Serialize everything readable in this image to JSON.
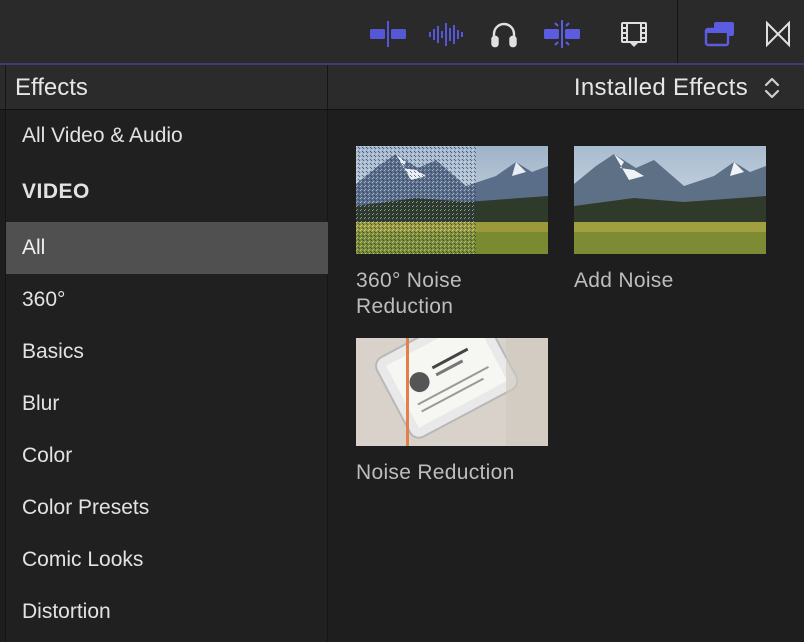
{
  "toolbar": {
    "icons": [
      "clip-appearance-icon",
      "audio-waveform-icon",
      "headphones-icon",
      "snapping-icon",
      "filmstrip-browser-icon",
      "inspector-toggle-icon",
      "transitions-icon"
    ]
  },
  "sidebar": {
    "title": "Effects",
    "items": [
      {
        "label": "All Video & Audio",
        "type": "item"
      },
      {
        "label": "VIDEO",
        "type": "section"
      },
      {
        "label": "All",
        "type": "item",
        "selected": true
      },
      {
        "label": "360°",
        "type": "item"
      },
      {
        "label": "Basics",
        "type": "item"
      },
      {
        "label": "Blur",
        "type": "item"
      },
      {
        "label": "Color",
        "type": "item"
      },
      {
        "label": "Color Presets",
        "type": "item"
      },
      {
        "label": "Comic Looks",
        "type": "item"
      },
      {
        "label": "Distortion",
        "type": "item"
      }
    ]
  },
  "browser": {
    "selector_label": "Installed Effects",
    "effects": [
      {
        "label": "360° Noise Reduction",
        "line1": "360° Noise",
        "line2": "Reduction"
      },
      {
        "label": "Add Noise",
        "line1": "Add Noise",
        "line2": ""
      },
      {
        "label": "Noise Reduction",
        "line1": "Noise Reduction",
        "line2": ""
      }
    ]
  },
  "colors": {
    "accent": "#5b5ce0",
    "selected_row": "#505050",
    "panel_bg": "#1e1e1e"
  }
}
